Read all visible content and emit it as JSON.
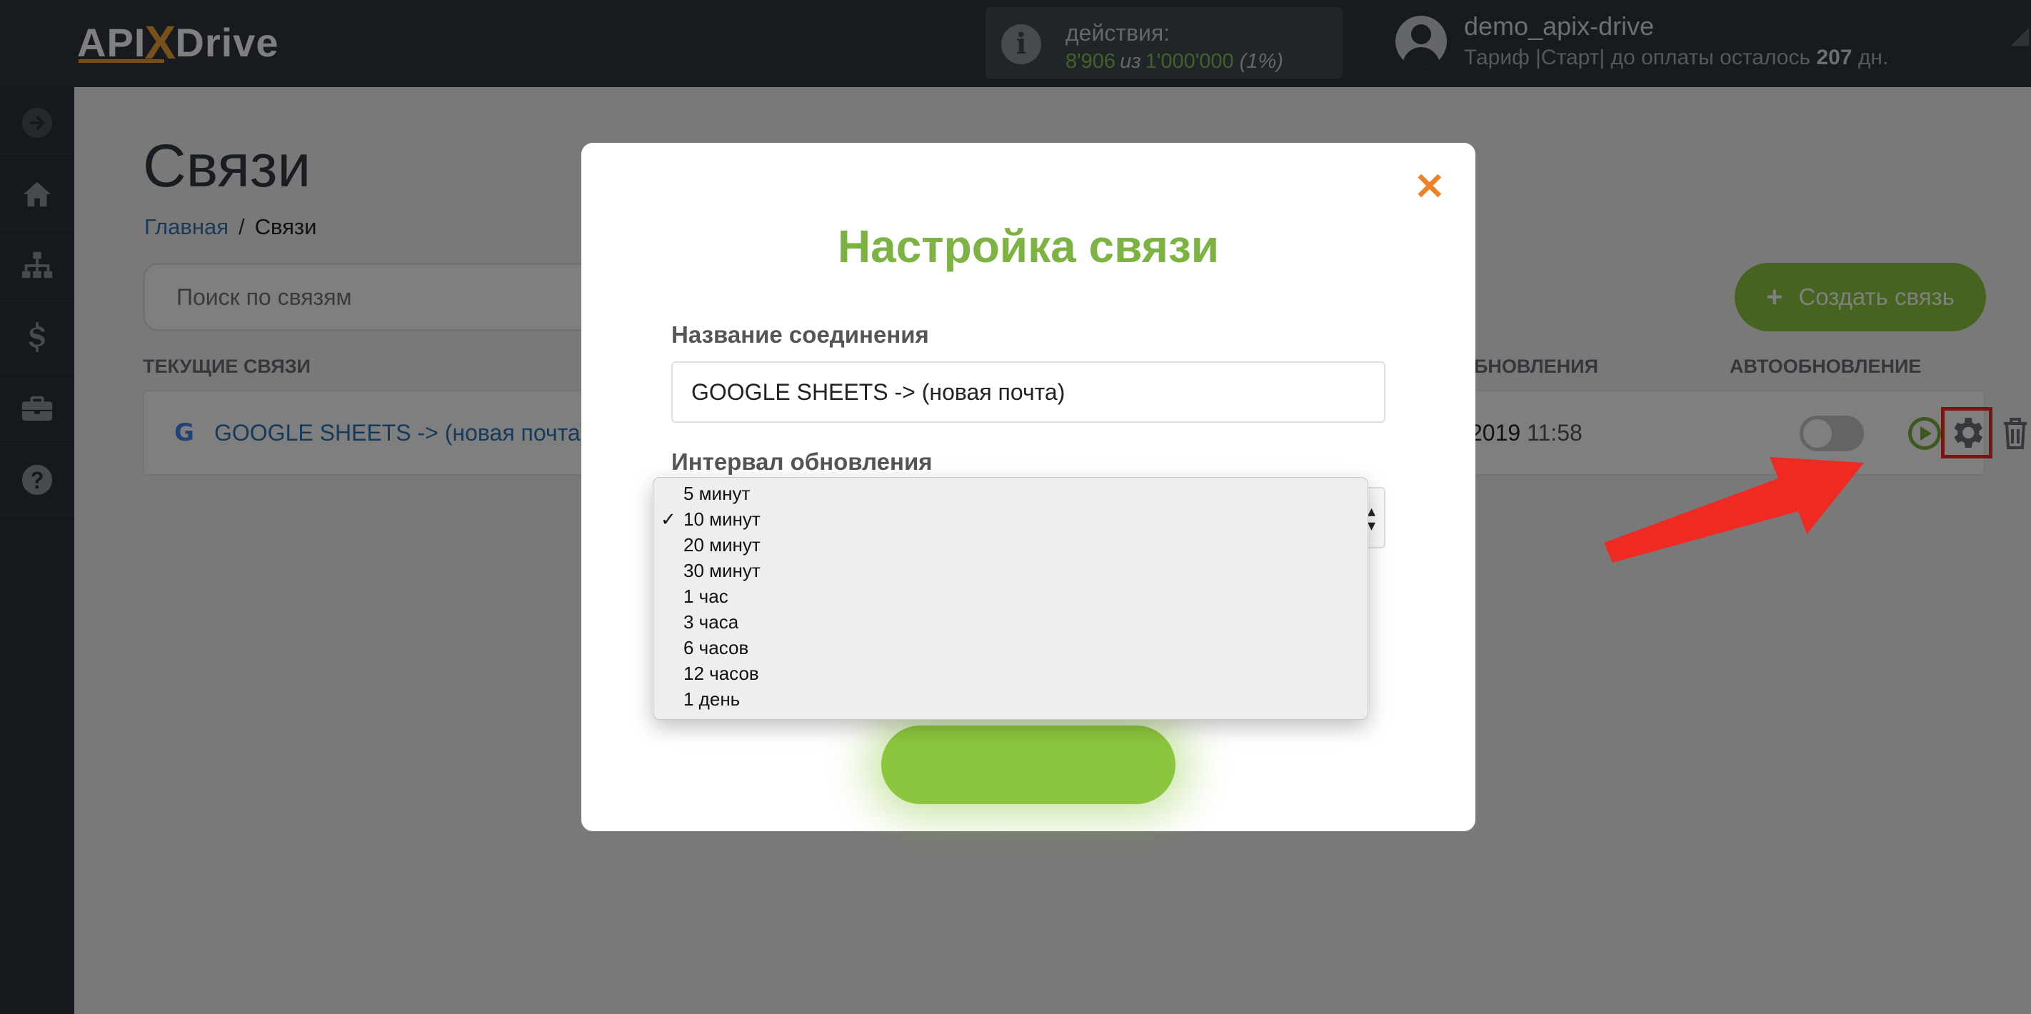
{
  "header": {
    "logo": {
      "part1": "API",
      "x": "X",
      "part2": "Drive"
    },
    "actions": {
      "label": "действия:",
      "used": "8'906",
      "of": "из",
      "total": "1'000'000",
      "percent": "(1%)"
    },
    "user": {
      "name": "demo_apix-drive",
      "tariff_prefix": "Тариф |Старт| до оплаты осталось",
      "days": "207",
      "days_suffix": "дн."
    }
  },
  "sidebar": {
    "items": [
      {
        "icon": "arrow-right-circle-icon"
      },
      {
        "icon": "home-icon"
      },
      {
        "icon": "sitemap-icon"
      },
      {
        "icon": "dollar-icon"
      },
      {
        "icon": "briefcase-icon"
      },
      {
        "icon": "question-circle-icon"
      }
    ]
  },
  "page": {
    "title": "Связи",
    "breadcrumb": {
      "home": "Главная",
      "separator": "/",
      "current": "Связи"
    },
    "search_placeholder": "Поиск по связям",
    "create_button": "Создать связь",
    "columns": {
      "current": "ТЕКУЩИЕ СВЯЗИ",
      "updated": "БНОВЛЕНИЯ",
      "autoupdate": "АВТООБНОВЛЕНИЕ"
    },
    "connection": {
      "name": "GOOGLE SHEETS -> (новая почта)",
      "date": "2019",
      "time": "11:58",
      "autoupdate_on": false
    }
  },
  "modal": {
    "title": "Настройка связи",
    "name_label": "Название соединения",
    "name_value": "GOOGLE SHEETS -> (новая почта)",
    "interval_label": "Интервал обновления",
    "interval_options": [
      "5 минут",
      "10 минут",
      "20 минут",
      "30 минут",
      "1 час",
      "3 часа",
      "6 часов",
      "12 часов",
      "1 день"
    ],
    "selected_option": "10 минут",
    "close_icon": "close-icon"
  },
  "colors": {
    "topbar": "#2e3640",
    "sidebar": "#2a323b",
    "brand_green": "#8cc63e",
    "title_green": "#7cb342",
    "close_orange": "#f08126",
    "highlight_red": "#ee2a23",
    "link_blue": "#2d74b8"
  }
}
